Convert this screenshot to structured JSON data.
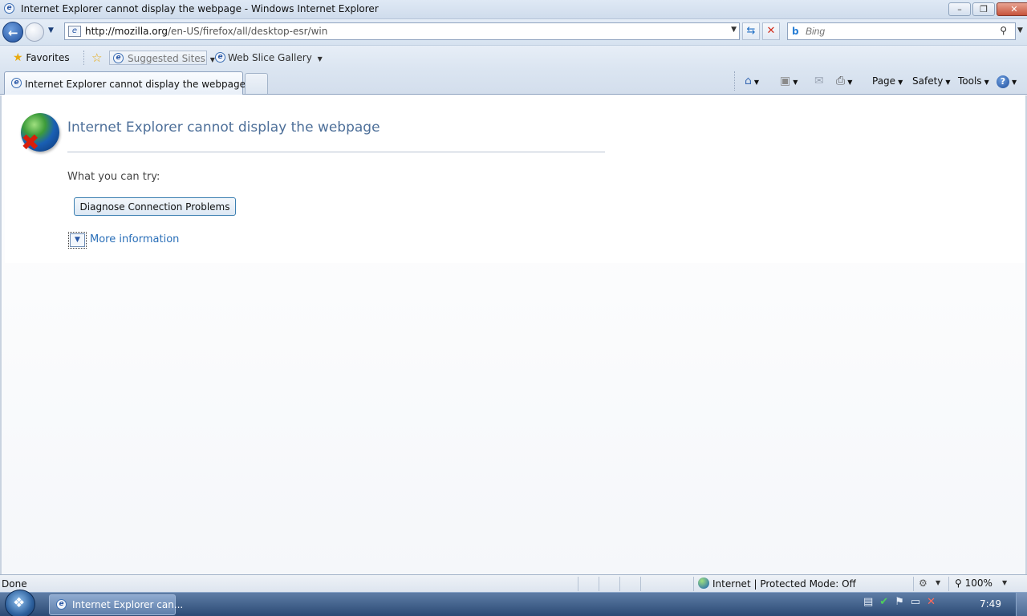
{
  "window": {
    "title": "Internet Explorer cannot display the webpage - Windows Internet Explorer",
    "minimize_glyph": "–",
    "maximize_glyph": "❐",
    "close_glyph": "✕"
  },
  "nav": {
    "url_host": "http://mozilla.org",
    "url_path": "/en-US/firefox/all/desktop-esr/win",
    "search_placeholder": "Bing",
    "refresh_glyph": "⇆",
    "stop_glyph": "✕"
  },
  "favorites_bar": {
    "favorites_label": "Favorites",
    "suggested_sites_label": "Suggested Sites",
    "web_slice_label": "Web Slice Gallery"
  },
  "tabs": [
    {
      "label": "Internet Explorer cannot display the webpage",
      "active": true
    }
  ],
  "command_bar": {
    "page_label": "Page",
    "safety_label": "Safety",
    "tools_label": "Tools",
    "help_glyph": "?"
  },
  "error_page": {
    "title": "Internet Explorer cannot display the webpage",
    "try_text": "What you can try:",
    "diagnose_button": "Diagnose Connection Problems",
    "more_info_link": "More information"
  },
  "status_bar": {
    "status": "Done",
    "zone": "Internet | Protected Mode: Off",
    "zoom": "100%"
  },
  "taskbar": {
    "ie_button_label": "Internet Explorer can...",
    "clock": "7:49"
  },
  "icons": {
    "back": "back-arrow-icon",
    "forward": "forward-arrow-icon",
    "search": "magnifier-icon",
    "home": "home-icon",
    "feeds": "rss-feed-icon",
    "mail": "mail-icon",
    "print": "printer-icon"
  },
  "colors": {
    "accent": "#2a6fb8",
    "error_title": "#4d6f99",
    "stop_red": "#d22c1b"
  }
}
